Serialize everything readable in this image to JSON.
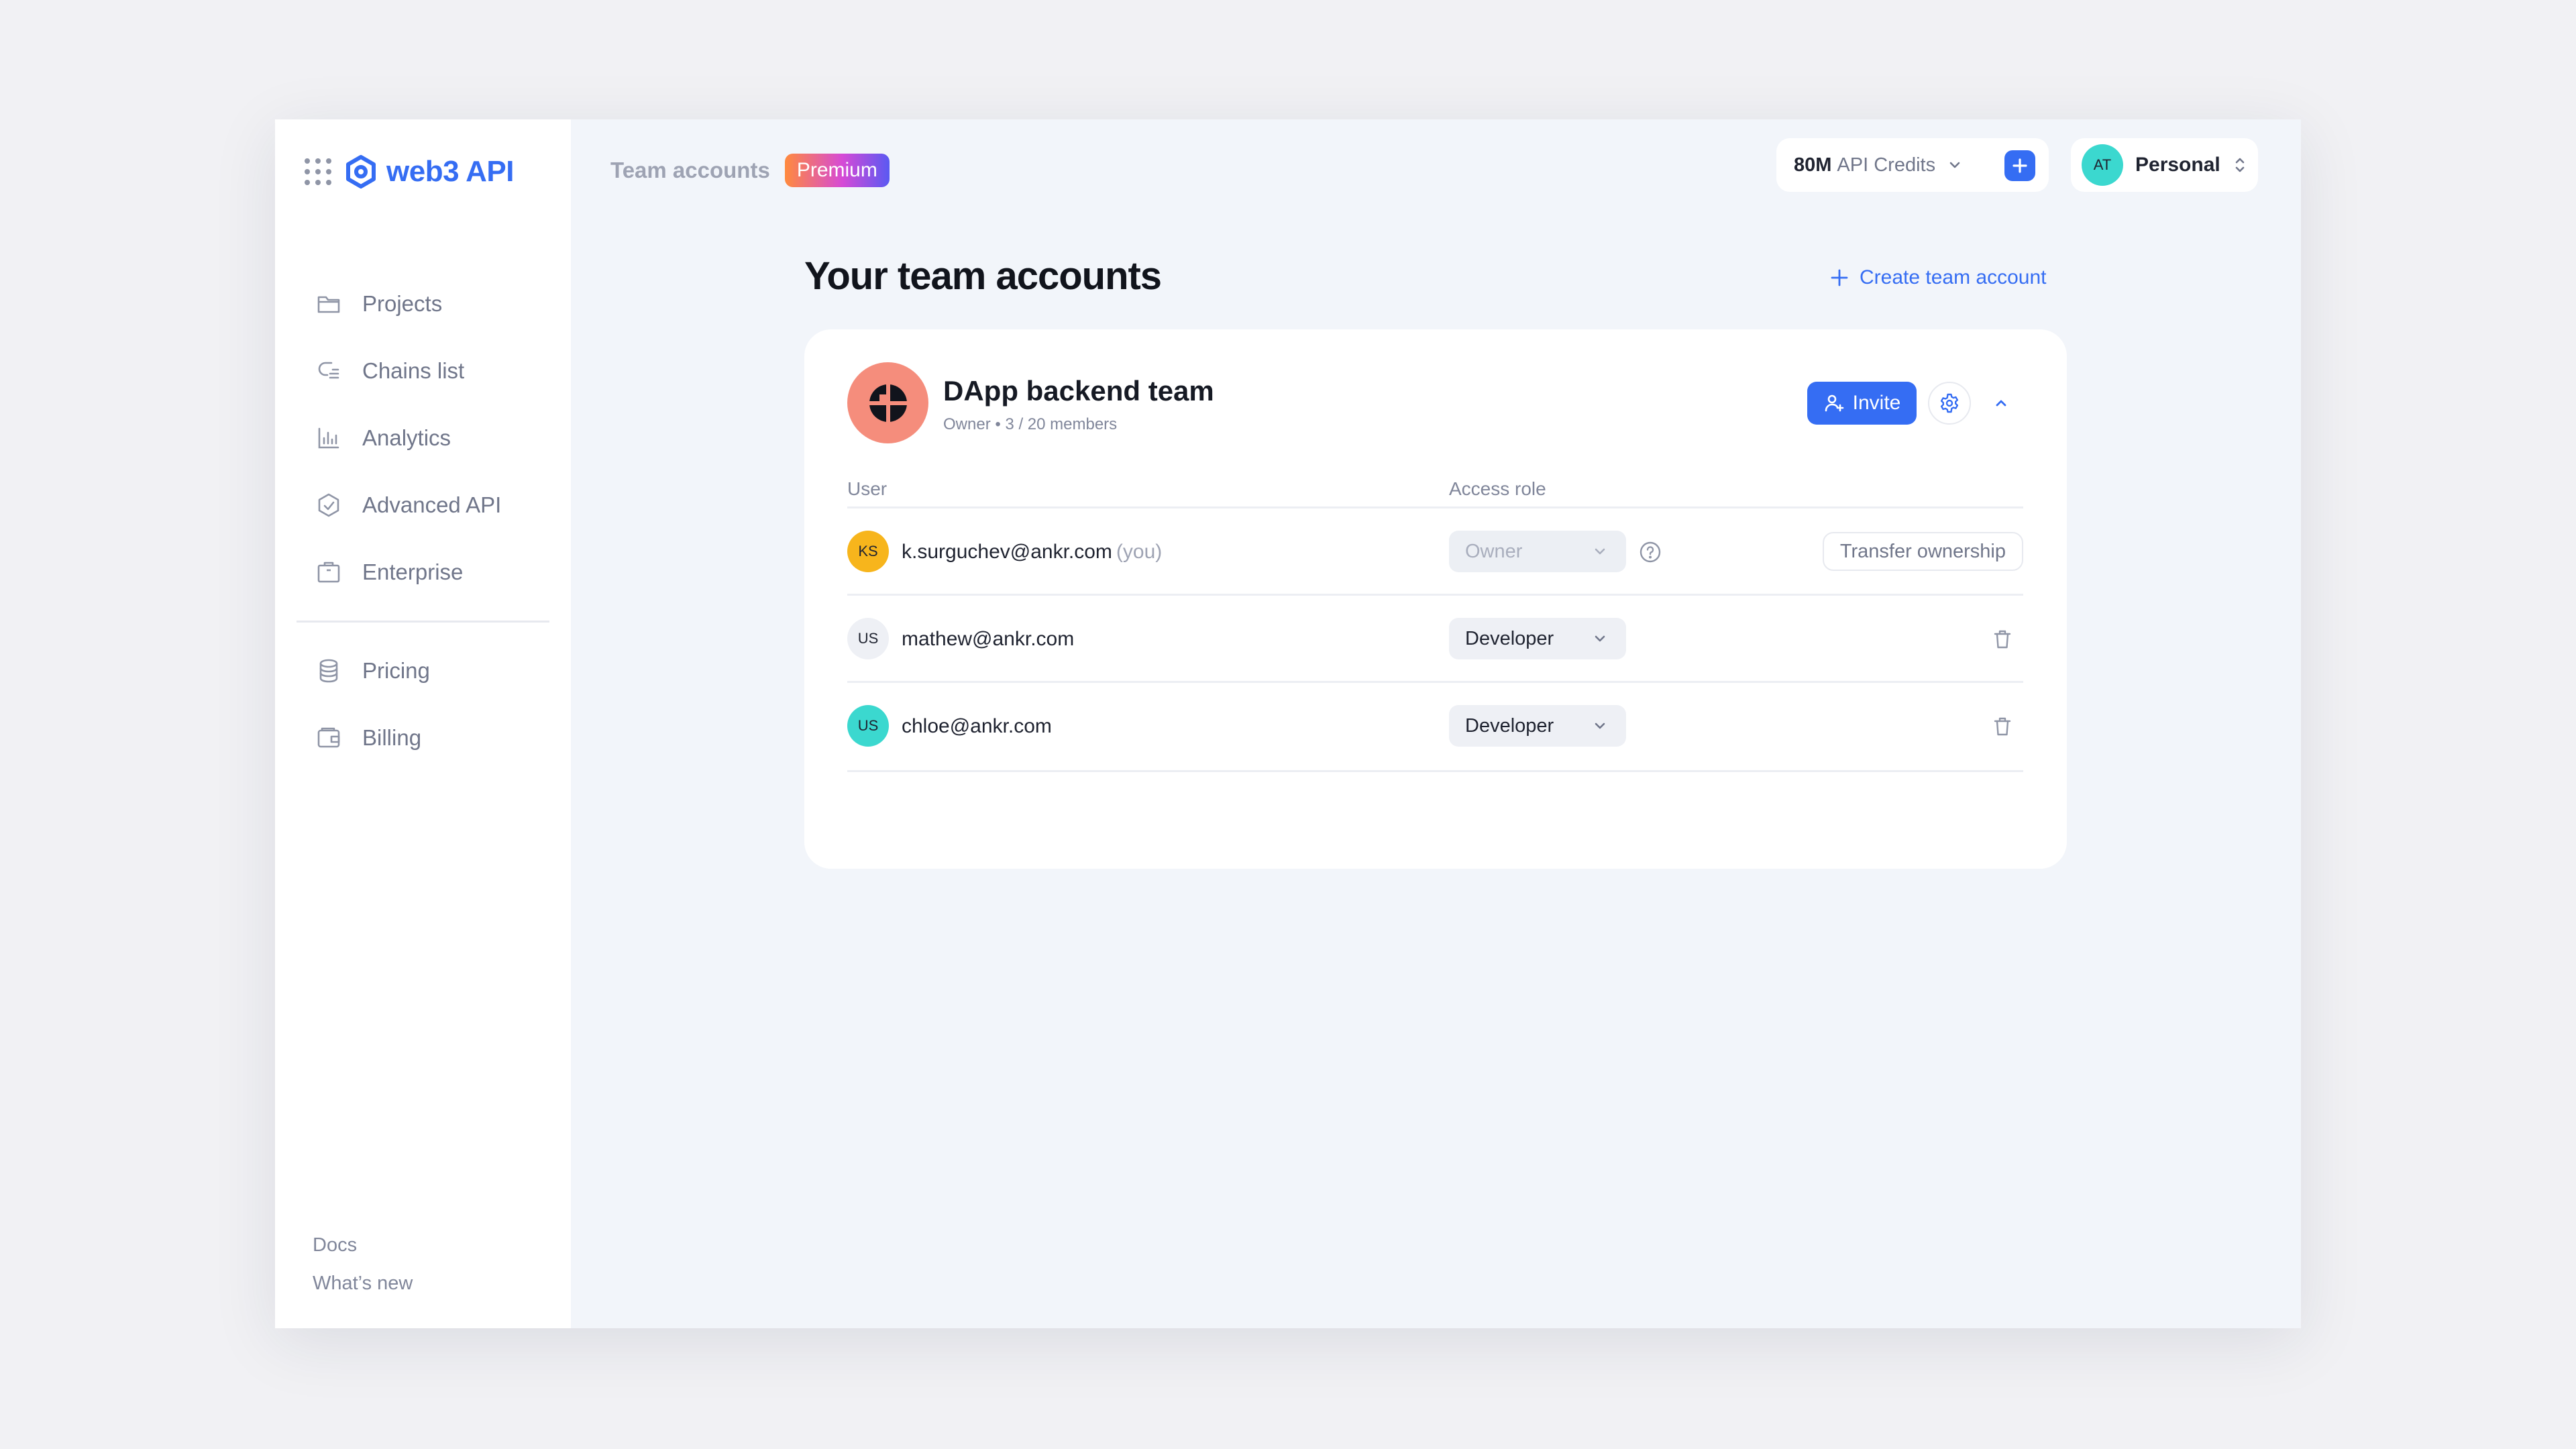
{
  "brand": {
    "name": "web3 API",
    "accent": "#356df3"
  },
  "sidebar": {
    "items": [
      {
        "label": "Projects",
        "icon": "folder-icon"
      },
      {
        "label": "Chains list",
        "icon": "chains-icon"
      },
      {
        "label": "Analytics",
        "icon": "chart-icon"
      },
      {
        "label": "Advanced API",
        "icon": "advanced-api-icon"
      },
      {
        "label": "Enterprise",
        "icon": "briefcase-icon"
      },
      {
        "label": "Pricing",
        "icon": "coins-icon"
      },
      {
        "label": "Billing",
        "icon": "wallet-icon"
      }
    ],
    "footer": {
      "docs": "Docs",
      "whats_new": "What’s new"
    }
  },
  "header": {
    "title": "Team accounts",
    "badge": "Premium",
    "credits": {
      "amount": "80M",
      "unit": "API Credits"
    },
    "account": {
      "initials": "AT",
      "name": "Personal",
      "avatar_color": "#3bd8cf"
    }
  },
  "main": {
    "title": "Your team accounts",
    "create_label": "Create team account",
    "team": {
      "name": "DApp backend team",
      "meta": "Owner • 3 / 20 members",
      "logo_color": "#f58d7c",
      "invite_label": "Invite",
      "columns": {
        "user": "User",
        "role": "Access role"
      },
      "members": [
        {
          "initials": "KS",
          "email": "k.surguchev@ankr.com",
          "you": "(you)",
          "role": "Owner",
          "avatar_color": "#f7b51c",
          "action": "Transfer ownership"
        },
        {
          "initials": "US",
          "email": "mathew@ankr.com",
          "role": "Developer",
          "avatar_color": "#eef0f5"
        },
        {
          "initials": "US",
          "email": "chloe@ankr.com",
          "role": "Developer",
          "avatar_color": "#3bd8cf"
        }
      ]
    }
  }
}
